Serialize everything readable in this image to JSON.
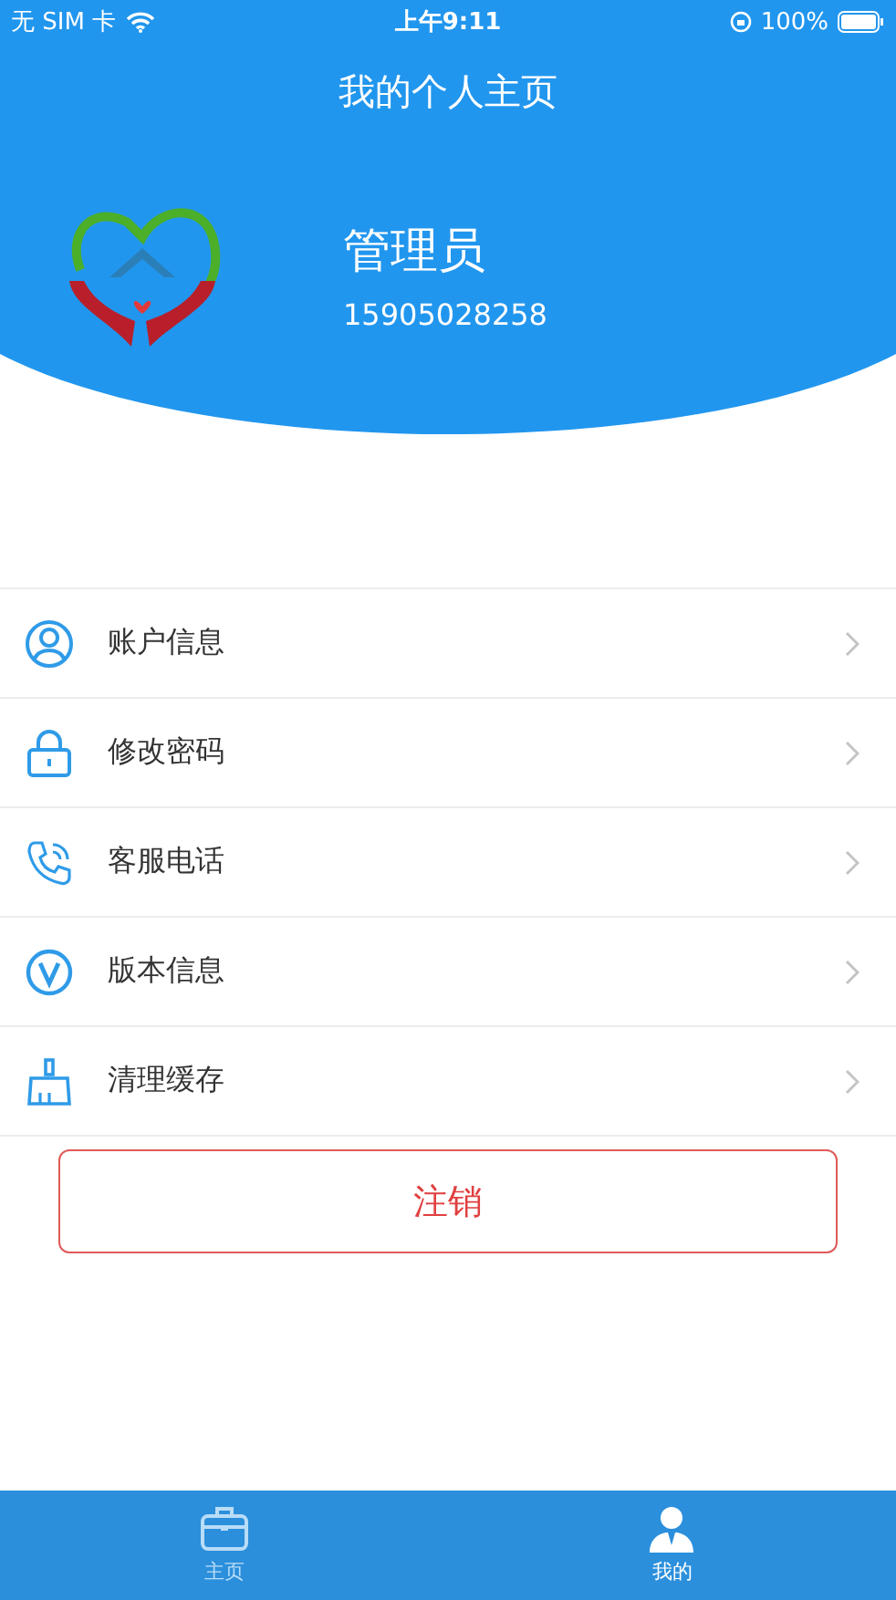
{
  "status_bar": {
    "carrier": "无 SIM 卡",
    "time": "上午9:11",
    "battery": "100%"
  },
  "header": {
    "title": "我的个人主页",
    "name": "管理员",
    "phone": "15905028258"
  },
  "menu": [
    {
      "kind": "user",
      "label": "账户信息"
    },
    {
      "kind": "lock",
      "label": "修改密码"
    },
    {
      "kind": "phone",
      "label": "客服电话"
    },
    {
      "kind": "version",
      "label": "版本信息"
    },
    {
      "kind": "broom",
      "label": "清理缓存"
    }
  ],
  "logout_button": "注销",
  "tab_bar": [
    {
      "kind": "briefcase",
      "label": "主页",
      "selected": false
    },
    {
      "kind": "person",
      "label": "我的",
      "selected": true
    }
  ]
}
